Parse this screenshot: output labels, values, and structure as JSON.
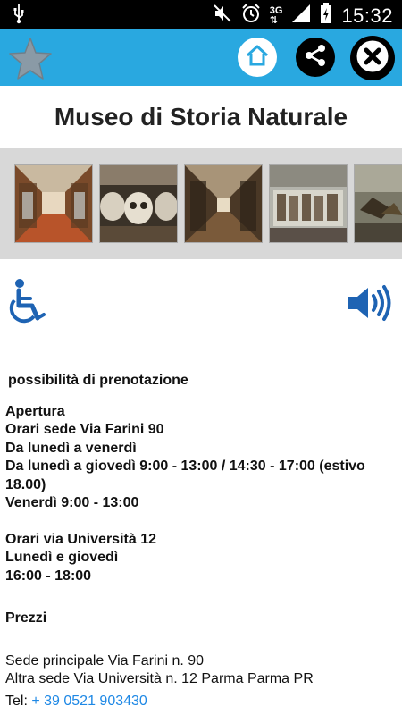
{
  "status_bar": {
    "time": "15:32",
    "network": "3G",
    "icons": [
      "usb-icon",
      "mute-icon",
      "alarm-icon",
      "signal-icon",
      "battery-charging-icon"
    ]
  },
  "app_bar": {
    "color": "#29a8e0",
    "icons": [
      "star-icon",
      "home-icon",
      "share-icon",
      "close-icon"
    ]
  },
  "page": {
    "title": "Museo di Storia Naturale"
  },
  "gallery": {
    "thumbnails": [
      "museum-corridor",
      "skulls-display",
      "gallery-hall",
      "display-cabinets",
      "specimens-case"
    ]
  },
  "accessibility": {
    "icons": [
      "wheelchair-icon",
      "speaker-icon"
    ]
  },
  "info": {
    "booking_note": "possibilità di prenotazione",
    "opening_heading": "Apertura",
    "hours_farini_heading": "Orari sede Via Farini 90",
    "farini_days": "Da lunedì a venerdì",
    "farini_mon_thu": "Da lunedì a giovedì 9:00 - 13:00 / 14:30 - 17:00 (estivo 18.00)",
    "farini_friday": "Venerdì 9:00 - 13:00",
    "hours_universita_heading": "Orari via Università 12",
    "universita_days": "Lunedì e giovedì",
    "universita_time": "16:00 - 18:00",
    "prices_heading": "Prezzi",
    "address_main": "Sede principale Via Farini n. 90",
    "address_other": "Altra sede Via Università n. 12 Parma Parma PR",
    "tel_label": "Tel: ",
    "tel_number": "+ 39 0521 903430"
  }
}
